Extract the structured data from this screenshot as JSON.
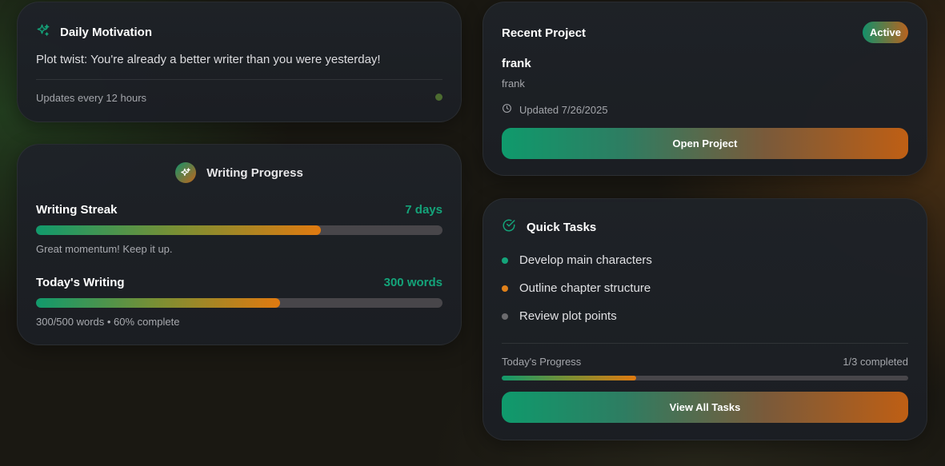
{
  "motivation": {
    "title": "Daily Motivation",
    "quote": "Plot twist: You're already a better writer than you were yesterday!",
    "footer": "Updates every 12 hours",
    "icon": "sparkles-icon"
  },
  "progress": {
    "title": "Writing Progress",
    "streak": {
      "label": "Writing Streak",
      "value": "7 days",
      "fraction": 0.7,
      "note": "Great momentum! Keep it up."
    },
    "today": {
      "label": "Today's Writing",
      "value": "300 words",
      "fraction": 0.6,
      "note": "300/500 words • 60% complete"
    }
  },
  "project": {
    "title": "Recent Project",
    "status": "Active",
    "name": "frank",
    "subtitle": "frank",
    "updated": "Updated 7/26/2025",
    "button": "Open Project"
  },
  "tasks": {
    "title": "Quick Tasks",
    "items": [
      {
        "label": "Develop main characters",
        "color": "#14a47a"
      },
      {
        "label": "Outline chapter structure",
        "color": "#e0801a"
      },
      {
        "label": "Review plot points",
        "color": "#6b6b6e"
      }
    ],
    "progress_label": "Today's Progress",
    "progress_value": "1/3 completed",
    "progress_fraction": 0.33,
    "button": "View All Tasks"
  },
  "colors": {
    "accent_green": "#14a47a",
    "accent_orange": "#e07a10"
  }
}
